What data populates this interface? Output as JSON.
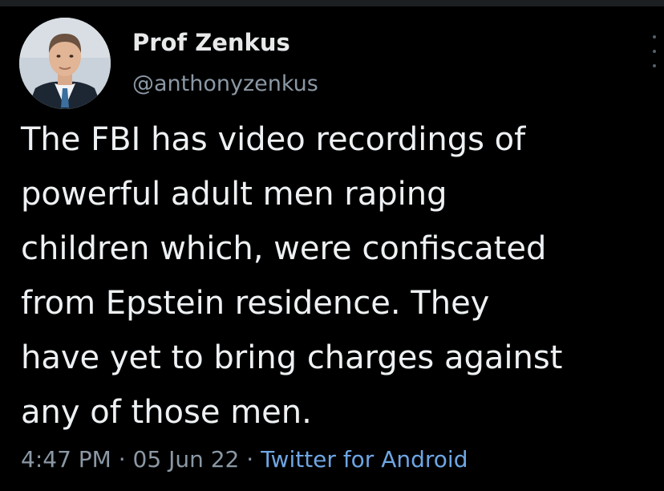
{
  "tweet": {
    "display_name": "Prof Zenkus",
    "handle": "@anthonyzenkus",
    "text_lines": [
      "The FBI has video recordings of",
      "powerful adult men raping",
      "children which, were confiscated",
      "from Epstein residence. They",
      "have yet to bring charges against",
      "any of those men."
    ],
    "time": "4:47 PM",
    "separator": "·",
    "date": "05 Jun 22",
    "source": "Twitter for Android"
  },
  "colors": {
    "background": "#000000",
    "text": "#e7e9ea",
    "secondary": "#8b98a5",
    "link": "#6ea6e3"
  },
  "icons": {
    "avatar": "profile-photo",
    "menu": "more-vertical-icon"
  }
}
